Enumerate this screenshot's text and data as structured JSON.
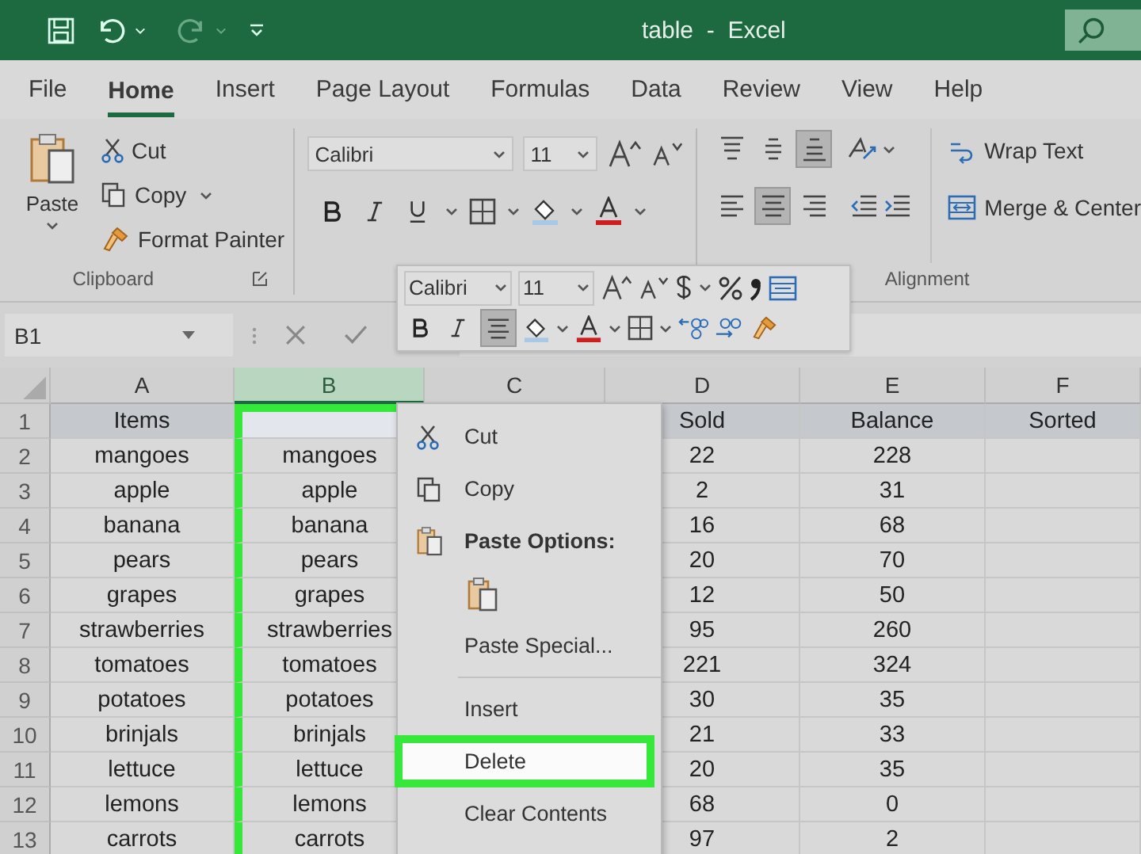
{
  "title_bar": {
    "title": "table  -  Excel"
  },
  "tabs": [
    {
      "label": "File",
      "selected": false
    },
    {
      "label": "Home",
      "selected": true
    },
    {
      "label": "Insert",
      "selected": false
    },
    {
      "label": "Page Layout",
      "selected": false
    },
    {
      "label": "Formulas",
      "selected": false
    },
    {
      "label": "Data",
      "selected": false
    },
    {
      "label": "Review",
      "selected": false
    },
    {
      "label": "View",
      "selected": false
    },
    {
      "label": "Help",
      "selected": false
    }
  ],
  "ribbon": {
    "clipboard": {
      "paste": "Paste",
      "cut": "Cut",
      "copy": "Copy",
      "format_painter": "Format Painter",
      "label": "Clipboard"
    },
    "font": {
      "family": "Calibri",
      "size": "11"
    },
    "alignment": {
      "vertical": [
        {
          "kind": "top",
          "selected": false
        },
        {
          "kind": "middle",
          "selected": false
        },
        {
          "kind": "bottom",
          "selected": true
        }
      ],
      "horizontal": [
        {
          "kind": "left",
          "selected": false
        },
        {
          "kind": "center",
          "selected": true
        },
        {
          "kind": "right",
          "selected": false
        }
      ],
      "wrap_text": "Wrap Text",
      "merge": "Merge & Center",
      "label": "Alignment"
    }
  },
  "name_box": "B1",
  "mini_toolbar": {
    "font": "Calibri",
    "size": "11",
    "center_selected": true
  },
  "sheet": {
    "columns": [
      {
        "label": "A",
        "selected": false
      },
      {
        "label": "B",
        "selected": true
      },
      {
        "label": "C",
        "selected": false
      },
      {
        "label": "D",
        "selected": false
      },
      {
        "label": "E",
        "selected": false
      },
      {
        "label": "F",
        "selected": false
      }
    ],
    "rows": [
      {
        "number": "1",
        "header": true,
        "cells": [
          "Items",
          null,
          null,
          "Sold",
          "Balance",
          "Sorted"
        ]
      },
      {
        "number": "2",
        "header": false,
        "cells": [
          "mangoes",
          "mangoes",
          null,
          "22",
          "228",
          null
        ]
      },
      {
        "number": "3",
        "header": false,
        "cells": [
          "apple",
          "apple",
          null,
          "2",
          "31",
          null
        ]
      },
      {
        "number": "4",
        "header": false,
        "cells": [
          "banana",
          "banana",
          null,
          "16",
          "68",
          null
        ]
      },
      {
        "number": "5",
        "header": false,
        "cells": [
          "pears",
          "pears",
          null,
          "20",
          "70",
          null
        ]
      },
      {
        "number": "6",
        "header": false,
        "cells": [
          "grapes",
          "grapes",
          null,
          "12",
          "50",
          null
        ]
      },
      {
        "number": "7",
        "header": false,
        "cells": [
          "strawberries",
          "strawberries",
          null,
          "95",
          "260",
          null
        ]
      },
      {
        "number": "8",
        "header": false,
        "cells": [
          "tomatoes",
          "tomatoes",
          null,
          "221",
          "324",
          null
        ]
      },
      {
        "number": "9",
        "header": false,
        "cells": [
          "potatoes",
          "potatoes",
          null,
          "30",
          "35",
          null
        ]
      },
      {
        "number": "10",
        "header": false,
        "cells": [
          "brinjals",
          "brinjals",
          null,
          "21",
          "33",
          null
        ]
      },
      {
        "number": "11",
        "header": false,
        "cells": [
          "lettuce",
          "lettuce",
          null,
          "20",
          "35",
          null
        ]
      },
      {
        "number": "12",
        "header": false,
        "cells": [
          "lemons",
          "lemons",
          null,
          "68",
          "0",
          null
        ]
      },
      {
        "number": "13",
        "header": false,
        "cells": [
          "carrots",
          "carrots",
          null,
          "97",
          "2",
          null
        ]
      }
    ]
  },
  "context_menu": [
    {
      "kind": "cut",
      "label": "Cut",
      "selected": false
    },
    {
      "kind": "copy",
      "label": "Copy",
      "selected": false
    },
    {
      "kind": "paste_options",
      "label": "Paste Options:",
      "selected": false
    },
    {
      "kind": "paste_icon"
    },
    {
      "kind": "plain",
      "label": "Paste Special...",
      "selected": false
    },
    {
      "kind": "separator"
    },
    {
      "kind": "plain",
      "label": "Insert",
      "selected": false
    },
    {
      "kind": "plain",
      "label": "Delete",
      "selected": true
    },
    {
      "kind": "plain",
      "label": "Clear Contents",
      "selected": false
    }
  ]
}
